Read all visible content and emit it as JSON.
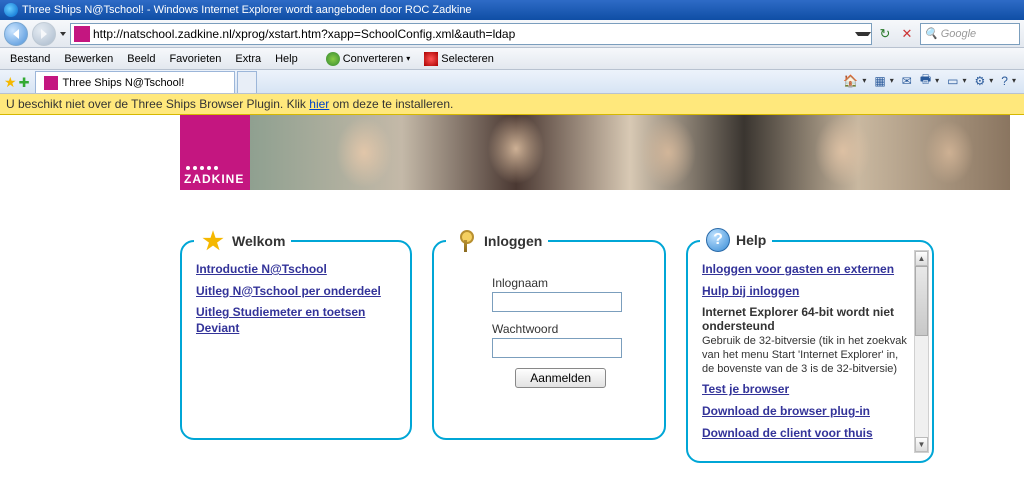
{
  "window": {
    "title": "Three Ships N@Tschool! - Windows Internet Explorer wordt aangeboden door ROC Zadkine"
  },
  "address": {
    "url": "http://natschool.zadkine.nl/xprog/xstart.htm?xapp=SchoolConfig.xml&auth=ldap"
  },
  "search": {
    "placeholder": "Google"
  },
  "menu": {
    "bestand": "Bestand",
    "bewerken": "Bewerken",
    "beeld": "Beeld",
    "favorieten": "Favorieten",
    "extra": "Extra",
    "help": "Help",
    "converteren": "Converteren",
    "selecteren": "Selecteren"
  },
  "tab": {
    "title": "Three Ships N@Tschool!"
  },
  "notice": {
    "pre": "U beschikt niet over de Three Ships Browser Plugin. Klik ",
    "link": "hier",
    "post": " om deze te installeren."
  },
  "logo": {
    "text": "ZADKINE"
  },
  "panels": {
    "welkom": {
      "title": "Welkom",
      "links": [
        "Introductie N@Tschool",
        "Uitleg N@Tschool per onderdeel",
        "Uitleg Studiemeter en toetsen Deviant"
      ]
    },
    "inloggen": {
      "title": "Inloggen",
      "user_label": "Inlognaam",
      "pass_label": "Wachtwoord",
      "button": "Aanmelden"
    },
    "help": {
      "title": "Help",
      "link1": "Inloggen voor gasten en externen",
      "link2": "Hulp bij inloggen",
      "head3": "Internet Explorer 64-bit wordt niet ondersteund",
      "desc3": "Gebruik de 32-bitversie (tik in het zoekvak van het menu Start 'Internet Explorer' in, de bovenste van de 3 is de 32-bitversie)",
      "link4": "Test je browser",
      "link5": "Download de browser plug-in",
      "link6": "Download de client voor thuis"
    }
  }
}
